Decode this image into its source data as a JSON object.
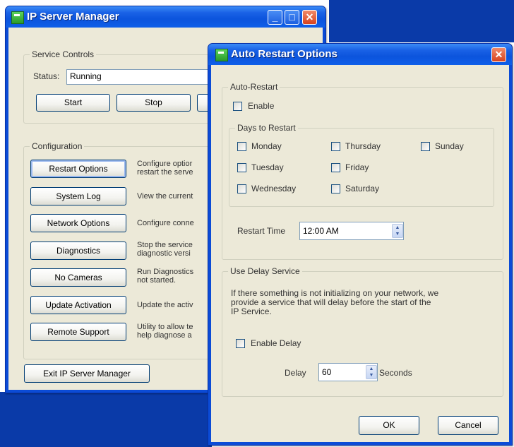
{
  "main_window": {
    "title": "IP Server Manager",
    "minimize_icon": "minimize-icon",
    "maximize_icon": "maximize-icon",
    "close_icon": "close-icon",
    "service_controls": {
      "label": "Service Controls",
      "status_label": "Status:",
      "status_value": "Running",
      "start_label": "Start",
      "stop_label": "Stop"
    },
    "configuration": {
      "label": "Configuration",
      "items": [
        {
          "button": "Restart Options",
          "desc1": "Configure optior",
          "desc2": "restart the serve"
        },
        {
          "button": "System Log",
          "desc1": "View the current",
          "desc2": ""
        },
        {
          "button": "Network Options",
          "desc1": "Configure conne",
          "desc2": ""
        },
        {
          "button": "Diagnostics",
          "desc1": "Stop the service",
          "desc2": "diagnostic versi"
        },
        {
          "button": "No Cameras",
          "desc1": "Run Diagnostics",
          "desc2": "not started."
        },
        {
          "button": "Update Activation",
          "desc1": "Update the activ",
          "desc2": ""
        },
        {
          "button": "Remote Support",
          "desc1": "Utility to allow te",
          "desc2": "help diagnose a"
        }
      ]
    },
    "exit_label": "Exit IP Server Manager"
  },
  "dialog": {
    "title": "Auto Restart Options",
    "close_icon": "close-icon",
    "auto_restart": {
      "label": "Auto-Restart",
      "enable_label": "Enable",
      "days_label": "Days to Restart",
      "days": [
        "Monday",
        "Tuesday",
        "Wednesday",
        "Thursday",
        "Friday",
        "Saturday",
        "Sunday"
      ],
      "restart_time_label": "Restart Time",
      "restart_time_value": "12:00 AM"
    },
    "delay_service": {
      "label": "Use Delay Service",
      "info_line1": "If there something is not initializing on your network, we",
      "info_line2": "provide a service that will delay before the start of the",
      "info_line3": "IP Service.",
      "enable_delay_label": "Enable Delay",
      "delay_label": "Delay",
      "delay_value": "60",
      "seconds_label": "Seconds"
    },
    "ok_label": "OK",
    "cancel_label": "Cancel"
  }
}
